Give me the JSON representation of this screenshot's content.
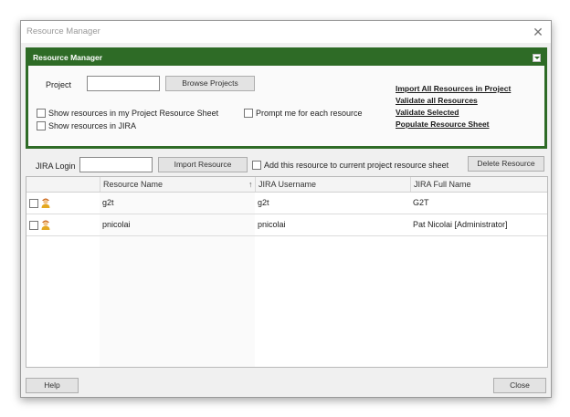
{
  "window": {
    "title": "Resource Manager"
  },
  "panel": {
    "header": "Resource Manager",
    "project_label": "Project",
    "project_value": "",
    "browse_button": "Browse Projects",
    "show_in_sheet": "Show resources in my Project Resource Sheet",
    "show_in_jira": "Show resources in JIRA",
    "prompt_each": "Prompt me for each resource",
    "links": {
      "import_all": "Import All Resources in Project",
      "validate_all": "Validate all Resources",
      "validate_selected": "Validate Selected",
      "populate": "Populate Resource Sheet"
    }
  },
  "toolbar": {
    "jira_login_label": "JIRA Login",
    "jira_login_value": "",
    "import_button": "Import Resource",
    "add_to_sheet": "Add this resource to current project resource sheet",
    "delete_button": "Delete Resource"
  },
  "grid": {
    "columns": [
      "",
      "Resource Name",
      "JIRA Username",
      "JIRA Full Name"
    ],
    "sort_indicator": "↑",
    "rows": [
      {
        "resource_name": "g2t",
        "jira_username": "g2t",
        "jira_full_name": "G2T"
      },
      {
        "resource_name": "pnicolai",
        "jira_username": "pnicolai",
        "jira_full_name": "Pat Nicolai [Administrator]"
      }
    ]
  },
  "footer": {
    "help_button": "Help",
    "close_button": "Close"
  },
  "icons": {
    "close": "close-icon",
    "collapse": "collapse-icon",
    "user": "user-icon"
  },
  "colors": {
    "panel_green": "#2e6b26"
  }
}
